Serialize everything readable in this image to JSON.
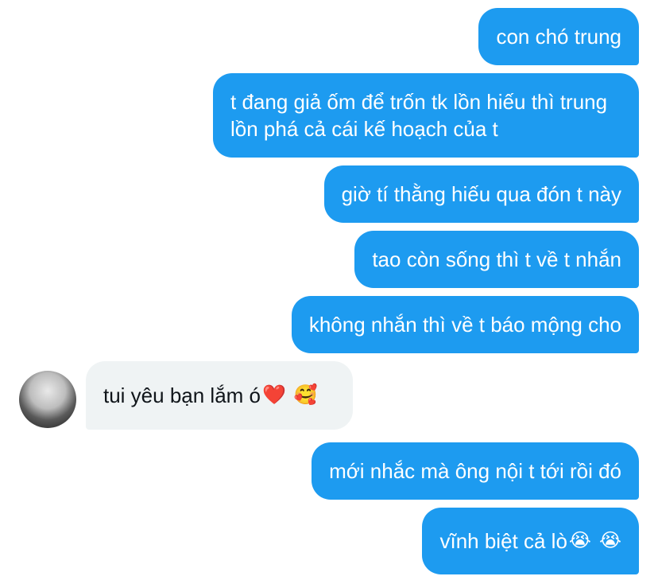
{
  "messages": [
    {
      "text": "con chó trung"
    },
    {
      "text": "t đang giả ốm để trốn tk lồn hiếu thì trung lồn phá cả cái kế hoạch của t"
    },
    {
      "text": "giờ tí thằng hiếu qua đón t này"
    },
    {
      "text": "tao còn sống thì t về t nhắn"
    },
    {
      "text": "không nhắn thì về t báo mộng cho"
    },
    {
      "text": "tui yêu bạn lắm ó",
      "emojis": [
        "❤️",
        "🥰"
      ]
    },
    {
      "text": "mới nhắc mà ông nội t tới rồi đó"
    },
    {
      "text": "vĩnh biệt cả lò",
      "emojis": [
        "😭",
        "😭"
      ]
    }
  ],
  "colors": {
    "sent_bubble": "#1d9bf0",
    "received_bubble": "#eff3f4",
    "sent_text": "#ffffff",
    "received_text": "#0f1419"
  },
  "icons": {
    "avatar": "user-avatar"
  }
}
